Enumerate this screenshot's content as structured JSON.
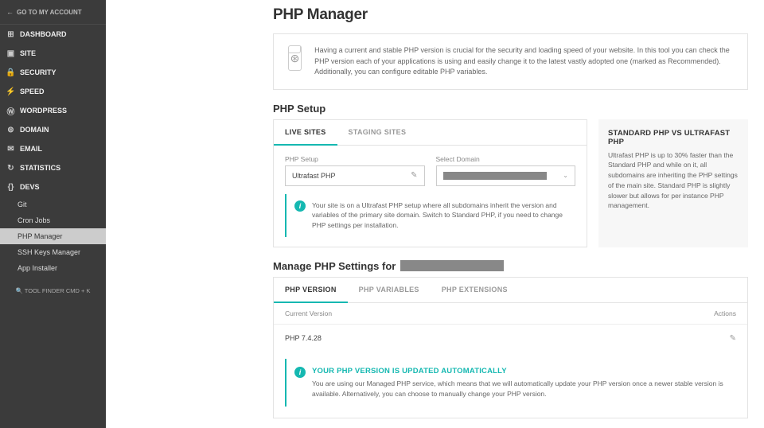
{
  "sidebar": {
    "go_account": "GO TO MY ACCOUNT",
    "items": [
      {
        "label": "DASHBOARD",
        "icon": "⊞"
      },
      {
        "label": "SITE",
        "icon": "▣"
      },
      {
        "label": "SECURITY",
        "icon": "🔒"
      },
      {
        "label": "SPEED",
        "icon": "⚡"
      },
      {
        "label": "WORDPRESS",
        "icon": "ⓦ"
      },
      {
        "label": "DOMAIN",
        "icon": "⊜"
      },
      {
        "label": "EMAIL",
        "icon": "✉"
      },
      {
        "label": "STATISTICS",
        "icon": "↻"
      },
      {
        "label": "DEVS",
        "icon": "{}"
      }
    ],
    "sub_items": [
      "Git",
      "Cron Jobs",
      "PHP Manager",
      "SSH Keys Manager",
      "App Installer"
    ],
    "tool_finder": "🔍 TOOL FINDER CMD + K"
  },
  "page": {
    "title": "PHP Manager",
    "intro": "Having a current and stable PHP version is crucial for the security and loading speed of your website. In this tool you can check the PHP version each of your applications is using and easily change it to the latest vastly adopted one (marked as Recommended). Additionally, you can configure editable PHP variables."
  },
  "setup": {
    "section_title": "PHP Setup",
    "tabs": [
      "LIVE SITES",
      "STAGING SITES"
    ],
    "php_setup_label": "PHP Setup",
    "php_setup_value": "Ultrafast PHP",
    "domain_label": "Select Domain",
    "info_text": "Your site is on a Ultrafast PHP setup where all subdomains inherit the version and variables of the primary site domain. Switch to Standard PHP, if you need to change PHP settings per installation."
  },
  "sidecard": {
    "title": "STANDARD PHP VS ULTRAFAST PHP",
    "text": "Ultrafast PHP is up to 30% faster than the Standard PHP and while on it, all subdomains are inheriting the PHP settings of the main site. Standard PHP is slightly slower but allows for per instance PHP management."
  },
  "manage": {
    "title_prefix": "Manage PHP Settings for",
    "tabs": [
      "PHP VERSION",
      "PHP VARIABLES",
      "PHP EXTENSIONS"
    ],
    "col_version": "Current Version",
    "col_actions": "Actions",
    "version_value": "PHP 7.4.28",
    "auto_title": "YOUR PHP VERSION IS UPDATED AUTOMATICALLY",
    "auto_text": "You are using our Managed PHP service, which means that we will automatically update your PHP version once a newer stable version is available. Alternatively, you can choose to manually change your PHP version."
  }
}
